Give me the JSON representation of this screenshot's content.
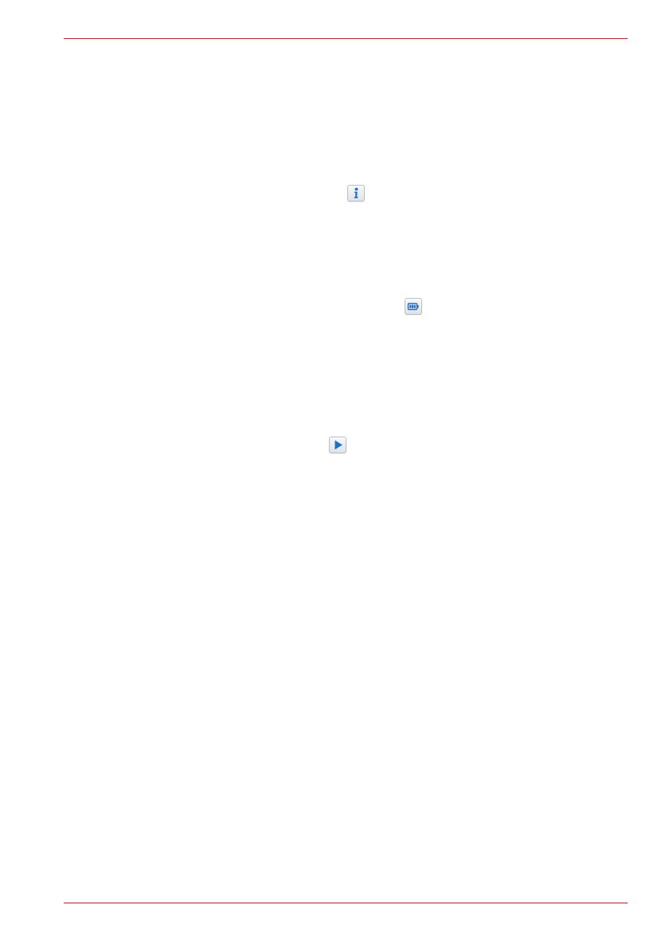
{
  "colors": {
    "header_rule": "#b2202a",
    "footer_rule": "#b2202a",
    "icon_blue": "#1f6fc4"
  },
  "icons": [
    {
      "name": "info-icon"
    },
    {
      "name": "battery-icon"
    },
    {
      "name": "play-icon"
    }
  ]
}
